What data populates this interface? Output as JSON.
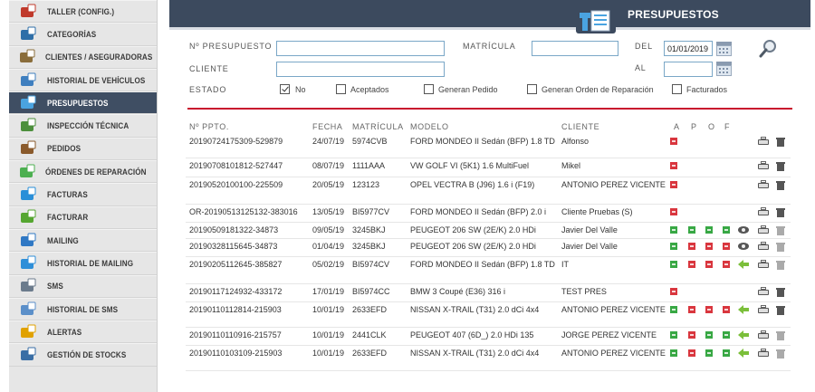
{
  "sidebar": {
    "items": [
      {
        "label": "TALLER (CONFIG.)",
        "icon": "garage-icon"
      },
      {
        "label": "CATEGORÍAS",
        "icon": "user-icon"
      },
      {
        "label": "CLIENTES / ASEGURADORAS",
        "icon": "clients-icon"
      },
      {
        "label": "HISTORIAL DE VEHÍCULOS",
        "icon": "car-history-icon"
      },
      {
        "label": "PRESUPUESTOS",
        "icon": "budget-icon",
        "active": true
      },
      {
        "label": "INSPECCIÓN TÉCNICA",
        "icon": "car-inspection-icon"
      },
      {
        "label": "PEDIDOS",
        "icon": "box-icon"
      },
      {
        "label": "ÓRDENES DE REPARACIÓN",
        "icon": "arrow-in-icon"
      },
      {
        "label": "FACTURAS",
        "icon": "arrow-right-icon"
      },
      {
        "label": "FACTURAR",
        "icon": "swap-arrows-icon"
      },
      {
        "label": "MAILING",
        "icon": "globe-mail-icon"
      },
      {
        "label": "HISTORIAL DE MAILING",
        "icon": "refresh-icon"
      },
      {
        "label": "SMS",
        "icon": "phone-plus-icon"
      },
      {
        "label": "HISTORIAL DE SMS",
        "icon": "phone-icon"
      },
      {
        "label": "ALERTAS",
        "icon": "alert-icon"
      },
      {
        "label": "GESTIÓN DE STOCKS",
        "icon": "stock-icon"
      }
    ]
  },
  "header": {
    "title": "PRESUPUESTOS"
  },
  "filters": {
    "n_presupuesto_label": "Nº PRESUPUESTO",
    "n_presupuesto_value": "",
    "matricula_label": "MATRÍCULA",
    "matricula_value": "",
    "del_label": "DEL",
    "del_value": "01/01/2019",
    "cliente_label": "CLIENTE",
    "cliente_value": "",
    "al_label": "AL",
    "al_value": "",
    "estado_label": "ESTADO",
    "estado_options": [
      {
        "label": "No",
        "checked": true
      },
      {
        "label": "Aceptados",
        "checked": false
      },
      {
        "label": "Generan Pedido",
        "checked": false
      },
      {
        "label": "Generan Orden de Reparación",
        "checked": false
      },
      {
        "label": "Facturados",
        "checked": false
      }
    ]
  },
  "table": {
    "headers": {
      "ppto": "Nº PPTO.",
      "fecha": "FECHA",
      "matricula": "MATRÍCULA",
      "modelo": "MODELO",
      "cliente": "CLIENTE",
      "a": "A",
      "p": "P",
      "o": "O",
      "f": "F"
    },
    "rows": [
      {
        "ppto": "20190724175309-529879",
        "fecha": "24/07/19",
        "matricula": "5974CVB",
        "modelo": "FORD MONDEO II Sedán (BFP) 1.8 TD",
        "cliente": "Alfonso",
        "status": [
          "red",
          "",
          "",
          ""
        ],
        "extra": "",
        "trash_dim": false
      },
      {
        "ppto": "20190708101812-527447",
        "fecha": "08/07/19",
        "matricula": "1111AAA",
        "modelo": "VW GOLF VI (5K1) 1.6 MultiFuel",
        "cliente": "Mikel",
        "status": [
          "red",
          "",
          "",
          ""
        ],
        "extra": "",
        "trash_dim": false
      },
      {
        "ppto": "20190520100100-225509",
        "fecha": "20/05/19",
        "matricula": "123123",
        "modelo": "OPEL VECTRA B (J96) 1.6 i (F19)",
        "cliente": "ANTONIO PEREZ VICENTE",
        "status": [
          "red",
          "",
          "",
          ""
        ],
        "extra": "",
        "trash_dim": false
      },
      {
        "ppto": "OR-20190513125132-383016",
        "fecha": "13/05/19",
        "matricula": "BI5977CV",
        "modelo": "FORD MONDEO II Sedán (BFP) 2.0 i",
        "cliente": "Cliente Pruebas (S)",
        "status": [
          "red",
          "",
          "",
          ""
        ],
        "extra": "",
        "trash_dim": false
      },
      {
        "ppto": "20190509181322-34873",
        "fecha": "09/05/19",
        "matricula": "3245BKJ",
        "modelo": "PEUGEOT 206 SW (2E/K) 2.0 HDi",
        "cliente": "Javier Del Valle",
        "status": [
          "green",
          "green",
          "green",
          "green"
        ],
        "extra": "eye",
        "trash_dim": true
      },
      {
        "ppto": "20190328115645-34873",
        "fecha": "01/04/19",
        "matricula": "3245BKJ",
        "modelo": "PEUGEOT 206 SW (2E/K) 2.0 HDi",
        "cliente": "Javier Del Valle",
        "status": [
          "green",
          "red",
          "red",
          "red"
        ],
        "extra": "eye",
        "trash_dim": true
      },
      {
        "ppto": "20190205112645-385827",
        "fecha": "05/02/19",
        "matricula": "BI5974CV",
        "modelo": "FORD MONDEO II Sedán (BFP) 1.8 TD",
        "cliente": "IT",
        "status": [
          "green",
          "red",
          "red",
          "red"
        ],
        "extra": "back",
        "trash_dim": true
      },
      {
        "ppto": "20190117124932-433172",
        "fecha": "17/01/19",
        "matricula": "BI5974CC",
        "modelo": "BMW 3 Coupé (E36) 316 i",
        "cliente": "TEST PRES",
        "status": [
          "red",
          "",
          "",
          ""
        ],
        "extra": "",
        "trash_dim": false
      },
      {
        "ppto": "20190110112814-215903",
        "fecha": "10/01/19",
        "matricula": "2633EFD",
        "modelo": "NISSAN X-TRAIL (T31) 2.0 dCi 4x4",
        "cliente": "ANTONIO PEREZ VICENTE",
        "status": [
          "green",
          "red",
          "red",
          "red"
        ],
        "extra": "back",
        "trash_dim": false
      },
      {
        "ppto": "20190110110916-215757",
        "fecha": "10/01/19",
        "matricula": "2441CLK",
        "modelo": "PEUGEOT 407 (6D_) 2.0 HDi 135",
        "cliente": "JORGE PEREZ VICENTE",
        "status": [
          "green",
          "red",
          "green",
          "green"
        ],
        "extra": "back",
        "trash_dim": true
      },
      {
        "ppto": "20190110103109-215903",
        "fecha": "10/01/19",
        "matricula": "2633EFD",
        "modelo": "NISSAN X-TRAIL (T31) 2.0 dCi 4x4",
        "cliente": "ANTONIO PEREZ VICENTE",
        "status": [
          "green",
          "red",
          "green",
          "green"
        ],
        "extra": "back",
        "trash_dim": true
      }
    ]
  }
}
